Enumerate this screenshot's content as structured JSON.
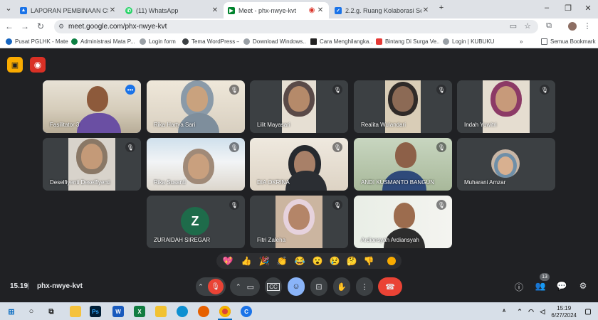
{
  "browser": {
    "tabs": [
      {
        "title": "LAPORAN PEMBINAAN CSAM",
        "icon": "google-drive-icon",
        "color": "#1a73e8"
      },
      {
        "title": "(11) WhatsApp",
        "icon": "whatsapp-icon",
        "color": "#25d366"
      },
      {
        "title": "Meet - phx-nwye-kvt",
        "icon": "meet-icon",
        "color": "#00832d"
      },
      {
        "title": "2.2.g. Ruang Kolaborasi Sesi 1",
        "icon": "tab-blue-icon",
        "color": "#1a73e8"
      }
    ],
    "url": "meet.google.com/phx-nwye-kvt",
    "bookmarks": [
      {
        "label": "Pusat PGLHK - Materi",
        "color": "#1565c0"
      },
      {
        "label": "Administrasi Mata P...",
        "color": "#0d8043"
      },
      {
        "label": "Login form",
        "color": "#5f6368"
      },
      {
        "label": "Tema WordPress –...",
        "color": "#3c4043"
      },
      {
        "label": "Download Windows...",
        "color": "#5f6368"
      },
      {
        "label": "Cara Menghilangka...",
        "color": "#222222"
      },
      {
        "label": "Bintang Di Surga Ve...",
        "color": "#e53935"
      },
      {
        "label": "Login | KUBUKU",
        "color": "#5f6368"
      }
    ],
    "all_bookmarks": "Semua Bookmark"
  },
  "meet": {
    "participants": [
      {
        "name": "Fasilitator 3"
      },
      {
        "name": "Rika Hartya Sari"
      },
      {
        "name": "Lilit Mayasari"
      },
      {
        "name": "Realita Wulandari"
      },
      {
        "name": "Indah Yuwitri"
      },
      {
        "name": "Deselfiyenti Deselfiyenti"
      },
      {
        "name": "Rika Susanti"
      },
      {
        "name": "DIA OKRINA"
      },
      {
        "name": "ANDI KUSMANTO BANGUN"
      },
      {
        "name": "Muharani Amzar"
      },
      {
        "name": "ZURAIDAH SIREGAR",
        "initial": "Z"
      },
      {
        "name": "Fitri Zaleha"
      },
      {
        "name": "Ardiansyah Ardiansyah"
      }
    ],
    "reactions": [
      "💖",
      "👍",
      "🎉",
      "👏",
      "😂",
      "😮",
      "😢",
      "🤔",
      "👎"
    ],
    "time": "15.19",
    "meeting_code": "phx-nwye-kvt",
    "people_count": "13"
  },
  "taskbar": {
    "time": "15:19",
    "date": "6/27/2024"
  }
}
